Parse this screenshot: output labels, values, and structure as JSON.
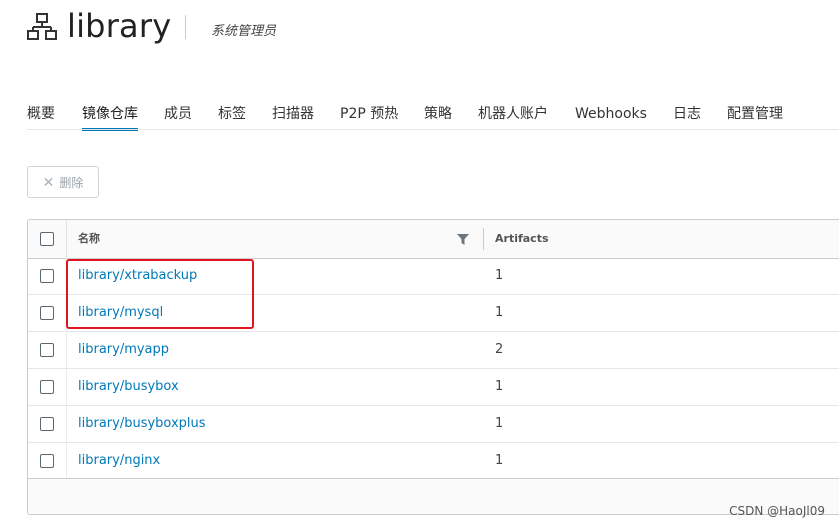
{
  "project": {
    "name": "library",
    "role": "系统管理员",
    "icon": "project-hierarchy-icon"
  },
  "tabs": [
    {
      "label": "概要",
      "active": false
    },
    {
      "label": "镜像仓库",
      "active": true
    },
    {
      "label": "成员",
      "active": false
    },
    {
      "label": "标签",
      "active": false
    },
    {
      "label": "扫描器",
      "active": false
    },
    {
      "label": "P2P 预热",
      "active": false
    },
    {
      "label": "策略",
      "active": false
    },
    {
      "label": "机器人账户",
      "active": false
    },
    {
      "label": "Webhooks",
      "active": false
    },
    {
      "label": "日志",
      "active": false
    },
    {
      "label": "配置管理",
      "active": false
    }
  ],
  "toolbar": {
    "delete_label": "删除",
    "delete_icon": "close-icon",
    "delete_disabled": true
  },
  "grid": {
    "columns": [
      {
        "label": "名称",
        "filter_icon": "filter-icon"
      },
      {
        "label": "Artifacts"
      }
    ],
    "rows": [
      {
        "name": "library/xtrabackup",
        "artifacts": "1"
      },
      {
        "name": "library/mysql",
        "artifacts": "1"
      },
      {
        "name": "library/myapp",
        "artifacts": "2"
      },
      {
        "name": "library/busybox",
        "artifacts": "1"
      },
      {
        "name": "library/busyboxplus",
        "artifacts": "1"
      },
      {
        "name": "library/nginx",
        "artifacts": "1"
      }
    ]
  },
  "colors": {
    "accent": "#0079b8",
    "highlight": "#e0151f"
  },
  "watermark": "CSDN @HaoJl09"
}
